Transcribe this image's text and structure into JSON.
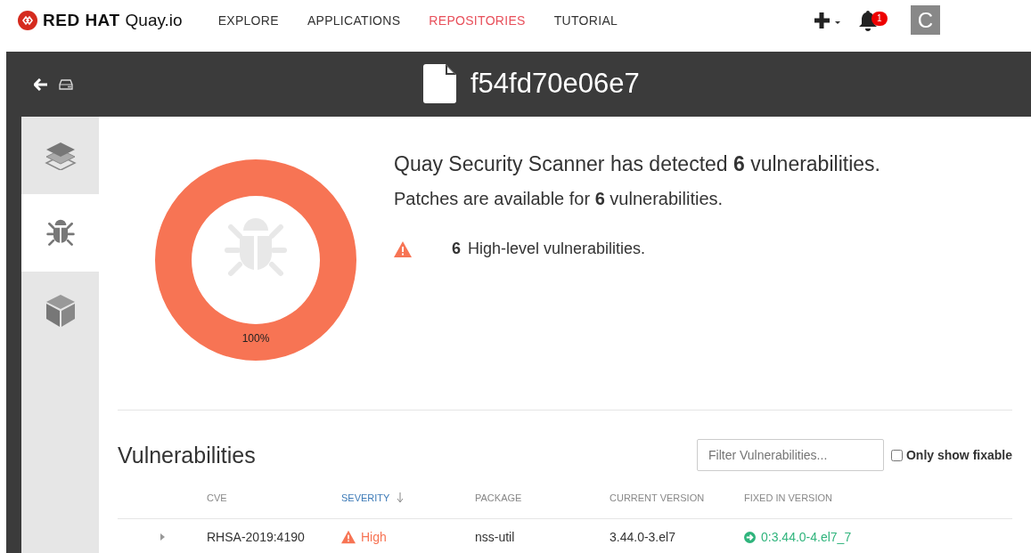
{
  "nav": {
    "brand": "RED HAT",
    "product": "Quay.io",
    "links": [
      {
        "label": "EXPLORE",
        "selected": false
      },
      {
        "label": "APPLICATIONS",
        "selected": false
      },
      {
        "label": "REPOSITORIES",
        "selected": true
      },
      {
        "label": "TUTORIAL",
        "selected": false
      }
    ],
    "notification_count": "1",
    "avatar": "C"
  },
  "header": {
    "title": "f54fd70e06e7"
  },
  "sidebar": {
    "items": [
      {
        "kind": "layers",
        "selected": false
      },
      {
        "kind": "bug",
        "selected": true
      },
      {
        "kind": "package",
        "selected": false
      }
    ]
  },
  "summary": {
    "donut": {
      "percent_label": "100%"
    },
    "headline": "Quay Security Scanner has detected **6** vulnerabilities.",
    "patches": "Patches are available for **6** vulnerabilities.",
    "levels": [
      {
        "count": "6",
        "label": "High-level vulnerabilities.",
        "color": "#f77454"
      }
    ]
  },
  "vulnerabilities": {
    "title": "Vulnerabilities",
    "filter": {
      "placeholder": "Filter Vulnerabilities..."
    },
    "only_fixable": {
      "label": "Only show fixable",
      "checked": false
    },
    "columns": [
      {
        "label": "CVE",
        "selected": false
      },
      {
        "label": "SEVERITY",
        "selected": true
      },
      {
        "label": "PACKAGE",
        "selected": false
      },
      {
        "label": "CURRENT VERSION",
        "selected": false
      },
      {
        "label": "FIXED IN VERSION",
        "selected": false
      }
    ],
    "rows": [
      {
        "expanded": false,
        "cve": "RHSA-2019:4190",
        "severity": "High",
        "color": "#f77454",
        "package": "nss-util",
        "current_version": "3.44.0-3.el7",
        "fixed_in_version": "0:3.44.0-4.el7_7"
      }
    ]
  }
}
